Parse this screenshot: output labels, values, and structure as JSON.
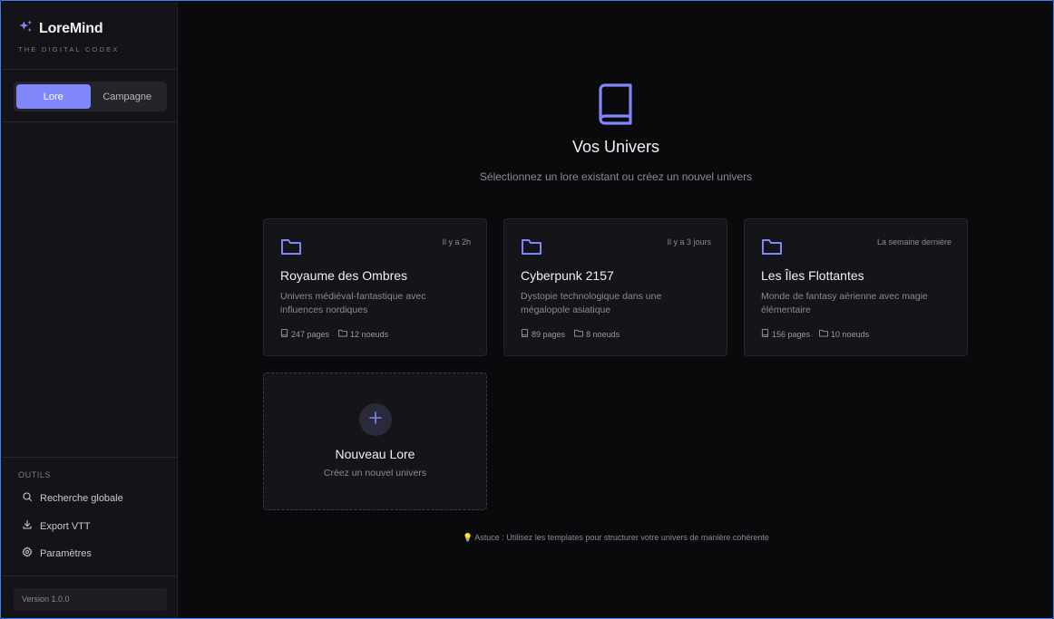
{
  "brand": {
    "name": "LoreMind",
    "subtitle": "THE DIGITAL CODEX",
    "accent": "#8087fa"
  },
  "mode_toggle": {
    "options": [
      "Lore",
      "Campagne"
    ],
    "active": "Lore"
  },
  "tools": {
    "title": "OUTILS",
    "items": [
      {
        "label": "Recherche globale",
        "icon": "search-icon"
      },
      {
        "label": "Export VTT",
        "icon": "download-icon"
      },
      {
        "label": "Paramètres",
        "icon": "gear-icon"
      }
    ]
  },
  "version": "Version 1.0.0",
  "hero": {
    "icon": "book-icon",
    "title": "Vos Univers",
    "subtitle": "Sélectionnez un lore existant ou créez un nouvel univers"
  },
  "universes": [
    {
      "title": "Royaume des Ombres",
      "time": "Il y a 2h",
      "description": "Univers médiéval-fantastique avec influences nordiques",
      "pages": "247 pages",
      "nodes": "12 noeuds"
    },
    {
      "title": "Cyberpunk 2157",
      "time": "Il y a 3 jours",
      "description": "Dystopie technologique dans une mégalopole asiatique",
      "pages": "89 pages",
      "nodes": "8 noeuds"
    },
    {
      "title": "Les Îles Flottantes",
      "time": "La semaine dernière",
      "description": "Monde de fantasy aérienne avec magie élémentaire",
      "pages": "156 pages",
      "nodes": "10 noeuds"
    }
  ],
  "new_lore": {
    "title": "Nouveau Lore",
    "subtitle": "Créez un nouvel univers"
  },
  "tip": {
    "icon": "lightbulb-icon",
    "text": "Astuce : Utilisez les templates pour structurer votre univers de manière cohérente"
  }
}
